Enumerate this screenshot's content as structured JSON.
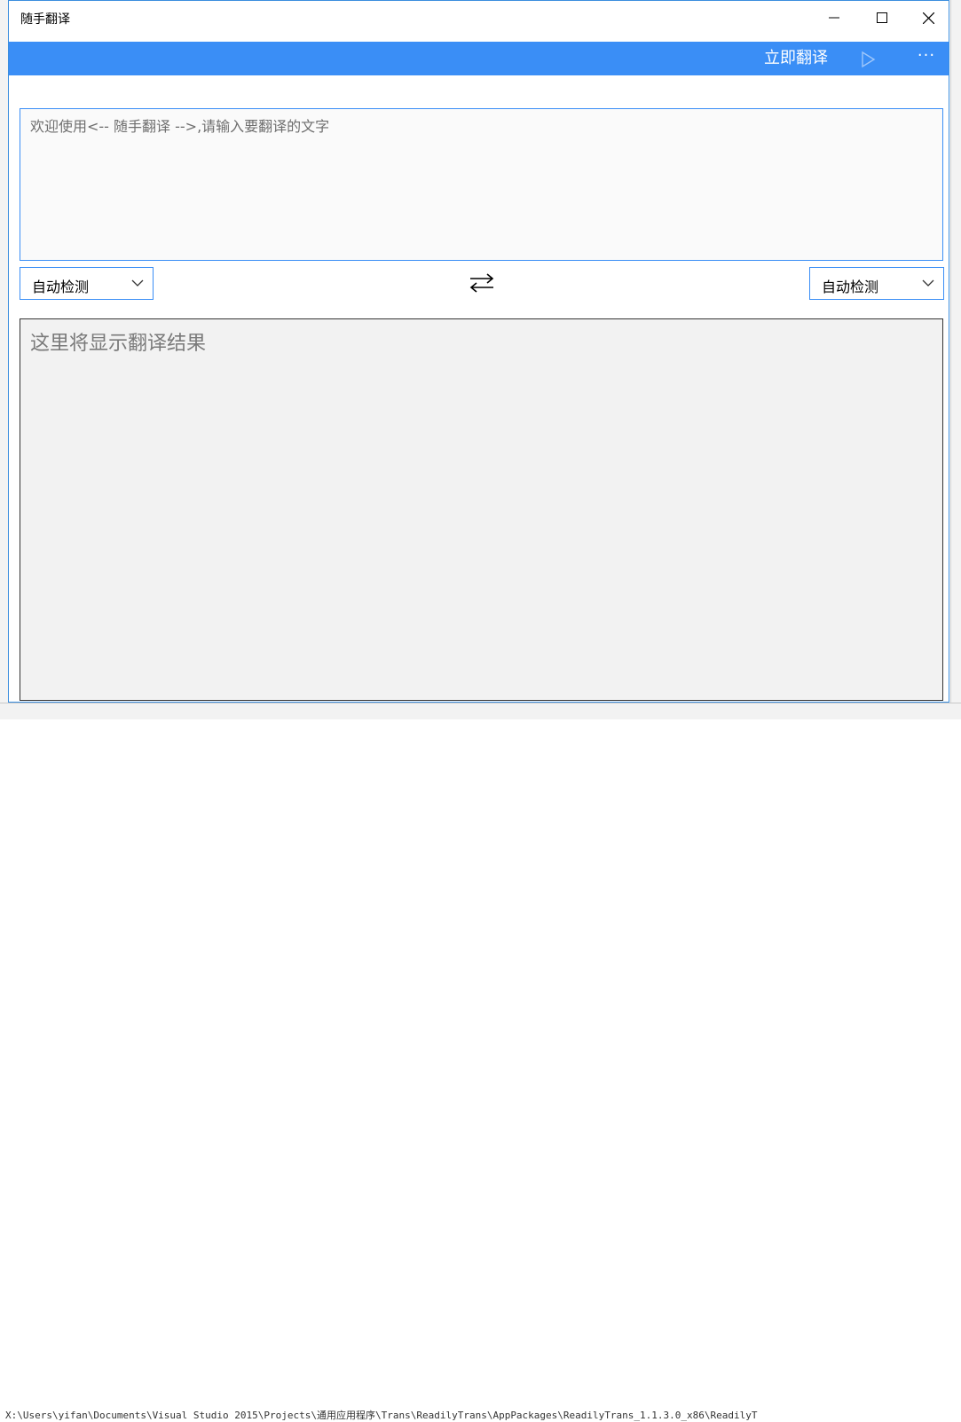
{
  "window": {
    "title": "随手翻译"
  },
  "toolbar": {
    "translate_label": "立即翻译",
    "more_label": "···"
  },
  "source": {
    "placeholder": "欢迎使用<-- 随手翻译 -->,请输入要翻译的文字"
  },
  "languages": {
    "source_selected": "自动检测",
    "target_selected": "自动检测"
  },
  "result": {
    "placeholder": "这里将显示翻译结果"
  },
  "background": {
    "path_text": "X:\\Users\\yifan\\Documents\\Visual Studio 2015\\Projects\\通用应用程序\\Trans\\ReadilyTrans\\AppPackages\\ReadilyTrans_1.1.3.0_x86\\ReadilyT"
  },
  "colors": {
    "accent": "#3a8ef6",
    "result_bg": "#f2f2f2",
    "source_bg": "#fafafa"
  },
  "icons": {
    "play": "play-icon",
    "swap": "swap-arrows-icon",
    "minimize": "minimize-icon",
    "maximize": "maximize-icon",
    "close": "close-icon",
    "chevron": "chevron-down-icon"
  }
}
